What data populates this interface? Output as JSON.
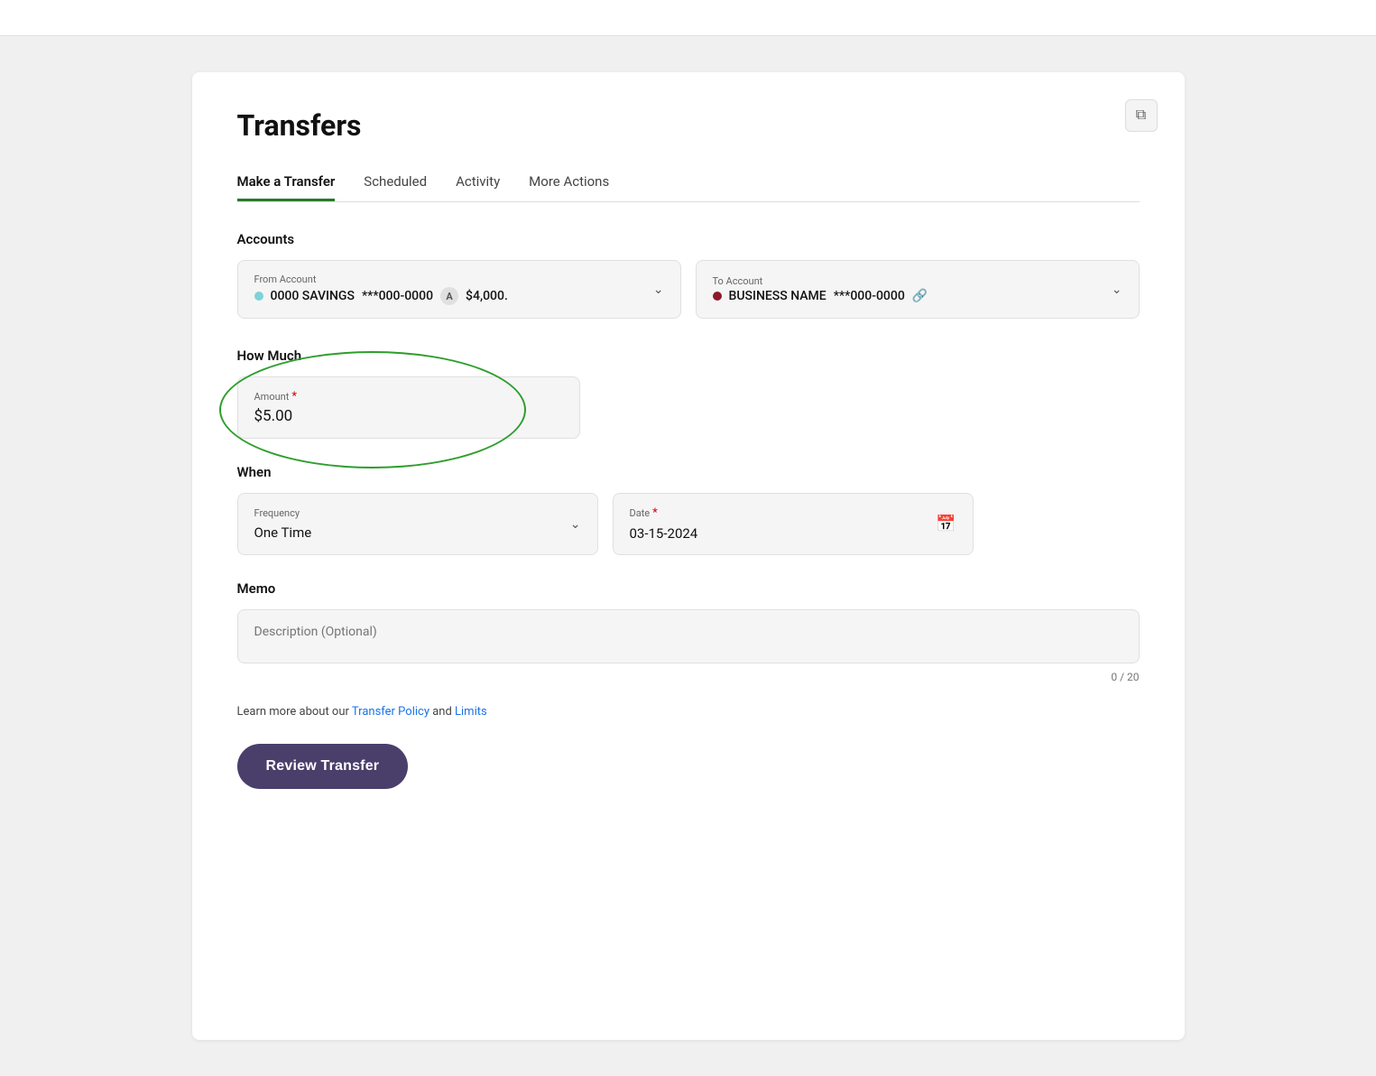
{
  "page": {
    "title": "Transfers",
    "copy_icon": "⧉"
  },
  "tabs": [
    {
      "id": "make-transfer",
      "label": "Make a Transfer",
      "active": true
    },
    {
      "id": "scheduled",
      "label": "Scheduled",
      "active": false
    },
    {
      "id": "activity",
      "label": "Activity",
      "active": false
    },
    {
      "id": "more-actions",
      "label": "More Actions",
      "active": false
    }
  ],
  "accounts_section": {
    "label": "Accounts",
    "from_account": {
      "field_label": "From Account",
      "account_name": "0000 SAVINGS",
      "account_number": "***000-0000",
      "balance": "$4,000."
    },
    "to_account": {
      "field_label": "To Account",
      "account_name": "BUSINESS NAME",
      "account_number": "***000-0000"
    }
  },
  "how_much": {
    "label": "How Much",
    "amount_field_label": "Amount",
    "amount_required": "*",
    "amount_value": "$5.00"
  },
  "when": {
    "label": "When",
    "frequency_field_label": "Frequency",
    "frequency_value": "One Time",
    "date_field_label": "Date",
    "date_required": "*",
    "date_value": "03-15-2024"
  },
  "memo": {
    "label": "Memo",
    "placeholder": "Description (Optional)",
    "char_count": "0 / 20"
  },
  "policy": {
    "text_before": "Learn more about our ",
    "link1": "Transfer Policy",
    "text_middle": " and ",
    "link2": "Limits"
  },
  "review_button": {
    "label": "Review Transfer"
  }
}
